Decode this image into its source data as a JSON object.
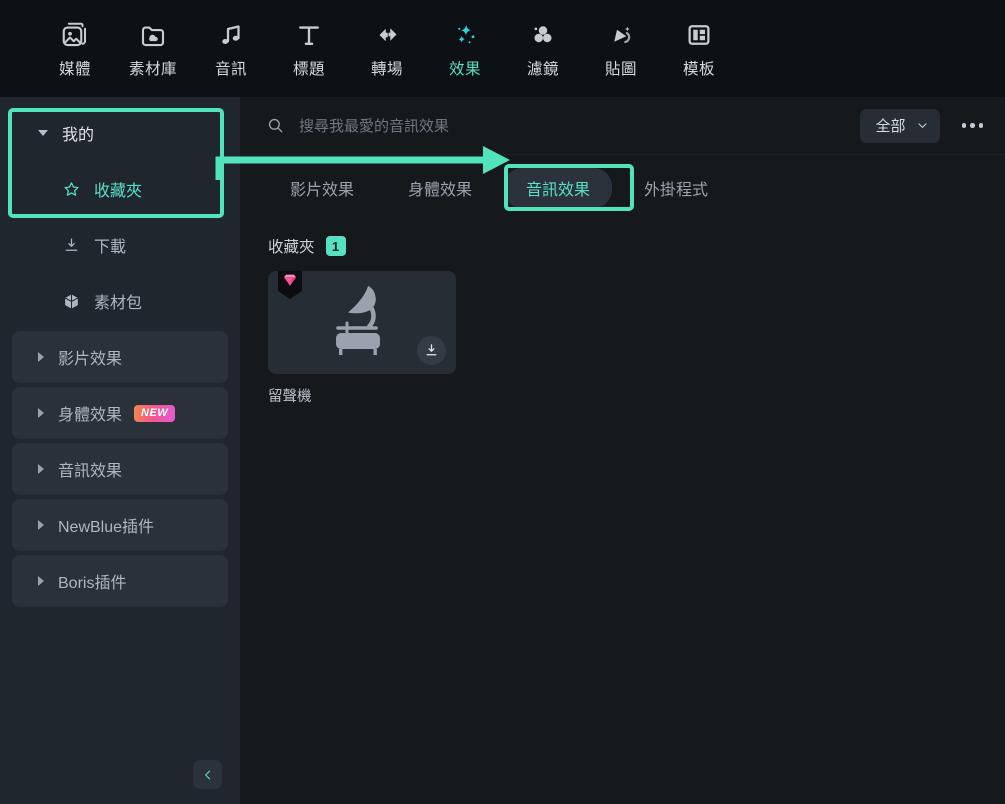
{
  "toolbar": {
    "items": [
      {
        "label": "媒體",
        "icon": "media-image-icon",
        "active": false
      },
      {
        "label": "素材庫",
        "icon": "stock-library-icon",
        "active": false
      },
      {
        "label": "音訊",
        "icon": "music-note-icon",
        "active": false
      },
      {
        "label": "標題",
        "icon": "text-title-icon",
        "active": false
      },
      {
        "label": "轉場",
        "icon": "transition-icon",
        "active": false
      },
      {
        "label": "效果",
        "icon": "effects-sparkle-icon",
        "active": true
      },
      {
        "label": "濾鏡",
        "icon": "filter-circles-icon",
        "active": false
      },
      {
        "label": "貼圖",
        "icon": "sticker-icon",
        "active": false
      },
      {
        "label": "模板",
        "icon": "template-layout-icon",
        "active": false
      }
    ]
  },
  "sidebar": {
    "items": [
      {
        "label": "我的",
        "type": "parent-expanded",
        "icon": "chevron-down-icon"
      },
      {
        "label": "收藏夾",
        "type": "child-selected",
        "icon": "star-icon"
      },
      {
        "label": "下載",
        "type": "child",
        "icon": "download-icon"
      },
      {
        "label": "素材包",
        "type": "child",
        "icon": "package-box-icon"
      },
      {
        "label": "影片效果",
        "type": "collapsed-group",
        "icon": "chevron-right-icon"
      },
      {
        "label": "身體效果",
        "type": "collapsed-group",
        "icon": "chevron-right-icon",
        "badge": "NEW"
      },
      {
        "label": "音訊效果",
        "type": "collapsed-group",
        "icon": "chevron-right-icon"
      },
      {
        "label": "NewBlue插件",
        "type": "collapsed-group",
        "icon": "chevron-right-icon"
      },
      {
        "label": "Boris插件",
        "type": "collapsed-group",
        "icon": "chevron-right-icon"
      }
    ],
    "collapse_icon": "chevron-left-icon"
  },
  "search": {
    "placeholder": "搜尋我最愛的音訊效果",
    "value": "",
    "icon": "search-icon"
  },
  "filter": {
    "label": "全部",
    "chevron_icon": "chevron-down-icon",
    "more_icon": "more-options-icon"
  },
  "tabs": [
    {
      "label": "影片效果",
      "active": false
    },
    {
      "label": "身體效果",
      "active": false
    },
    {
      "label": "音訊效果",
      "active": true
    },
    {
      "label": "外掛程式",
      "active": false
    }
  ],
  "content": {
    "section_title": "收藏夾",
    "section_count": "1",
    "cards": [
      {
        "label": "留聲機",
        "thumb_icon": "gramophone-icon",
        "premium_icon": "pink-diamond-badge-icon",
        "download_icon": "download-circle-icon"
      }
    ]
  },
  "annotations": {
    "highlight_color": "#52e3bb",
    "sidebar_box": "我的 / 收藏夾",
    "tab_box": "音訊效果",
    "arrow": "sidebar-to-audio-effects-tab"
  }
}
